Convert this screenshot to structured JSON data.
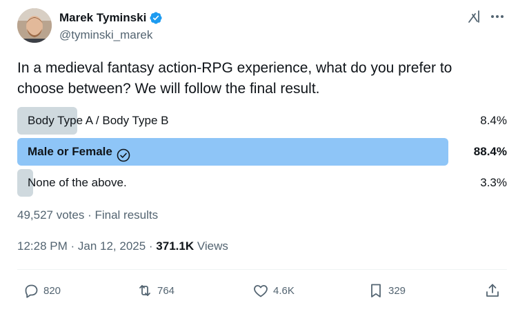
{
  "author": {
    "display_name": "Marek Tyminski",
    "handle": "@tyminski_marek"
  },
  "tweet": {
    "text": "In a medieval fantasy action-RPG experience, what do you prefer to choose between? We will follow the final result."
  },
  "poll": {
    "options": [
      {
        "label": "Body Type A / Body Type B",
        "percent": "8.4%",
        "value": 8.4
      },
      {
        "label": "Male or Female",
        "percent": "88.4%",
        "value": 88.4
      },
      {
        "label": "None of the above.",
        "percent": "3.3%",
        "value": 3.3
      }
    ],
    "votes": "49,527 votes",
    "status": "Final results",
    "separator": " · "
  },
  "meta": {
    "time": "12:28 PM",
    "date": "Jan 12, 2025",
    "views_count": "371.1K",
    "views_label": "Views",
    "separator": " · "
  },
  "actions": {
    "replies": "820",
    "reposts": "764",
    "likes": "4.6K",
    "bookmarks": "329"
  },
  "colors": {
    "accent": "#1d9bf0",
    "winner_bar": "#8ec5f7",
    "bar": "#cfd9de",
    "muted_text": "#536471",
    "text": "#0f1419"
  },
  "icons": {
    "verified": "verified-badge-icon",
    "grok": "grok-icon",
    "more": "more-icon",
    "reply": "reply-icon",
    "repost": "repost-icon",
    "like": "heart-icon",
    "bookmark": "bookmark-icon",
    "share": "share-icon",
    "check": "check-circle-icon"
  }
}
